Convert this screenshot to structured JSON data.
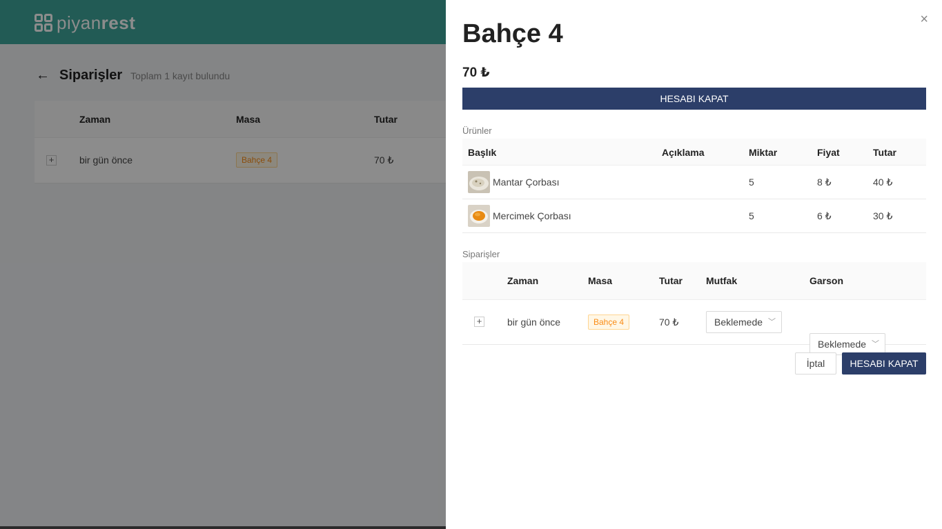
{
  "app": {
    "logo_text_light": "piyan",
    "logo_text_bold": "rest",
    "page_title": "Siparişler",
    "page_subtitle": "Toplam 1 kayıt bulundu",
    "table": {
      "headers": [
        "Zaman",
        "Masa",
        "Tutar"
      ],
      "rows": [
        {
          "expand": "+",
          "time": "bir gün önce",
          "table": "Bahçe 4",
          "amount": "70 ₺"
        }
      ]
    }
  },
  "drawer": {
    "title": "Bahçe 4",
    "total": "70 ₺",
    "close_label": "×",
    "close_account_label": "HESABI KAPAT",
    "products_label": "Ürünler",
    "products": {
      "headers": [
        "Başlık",
        "Açıklama",
        "Miktar",
        "Fiyat",
        "Tutar"
      ],
      "rows": [
        {
          "title": "Mantar Çorbası",
          "description": "",
          "qty": "5",
          "price": "8 ₺",
          "total": "40 ₺"
        },
        {
          "title": "Mercimek Çorbası",
          "description": "",
          "qty": "5",
          "price": "6 ₺",
          "total": "30 ₺"
        }
      ]
    },
    "orders_label": "Siparişler",
    "orders": {
      "headers": [
        "Zaman",
        "Masa",
        "Tutar",
        "Mutfak",
        "Garson"
      ],
      "rows": [
        {
          "expand": "+",
          "time": "bir gün önce",
          "table": "Bahçe 4",
          "amount": "70 ₺",
          "kitchen": "Beklemede",
          "waiter": "Beklemede"
        }
      ]
    },
    "cancel_label": "İptal",
    "footer_close_label": "HESABI KAPAT"
  },
  "colors": {
    "topbar": "#3ea69b",
    "primary": "#2c3e69",
    "tag_border": "#ffd591",
    "tag_bg": "#fff7e6",
    "tag_text": "#fa8c16"
  },
  "icons": [
    "logo-icon",
    "back-arrow-icon",
    "close-icon",
    "plus-icon",
    "chevron-down-icon"
  ]
}
